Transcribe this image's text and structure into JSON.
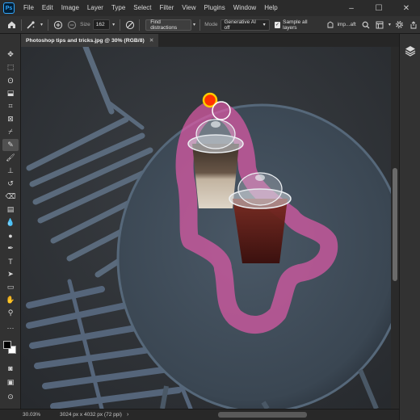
{
  "app": {
    "logo": "Ps"
  },
  "menubar": {
    "items": [
      "File",
      "Edit",
      "Image",
      "Layer",
      "Type",
      "Select",
      "Filter",
      "View",
      "Plugins",
      "Window",
      "Help"
    ]
  },
  "window_controls": {
    "minimize": "–",
    "maximize": "☐",
    "close": "✕"
  },
  "options_bar": {
    "size_label": "Size",
    "size_value": "162",
    "find_distractions": "Find distractions",
    "mode_label": "Mode",
    "mode_value": "Generative AI off",
    "sample_all_layers": "Sample all layers",
    "sample_checked": "✓",
    "truncated_label": "imp...aft"
  },
  "document": {
    "tab_title": "Photoshop tips and tricks.jpg @ 30% (RGB/8)",
    "close": "✕"
  },
  "status": {
    "zoom": "30.03%",
    "dimensions": "3024 px x 4032 px (72 ppi)"
  },
  "colors": {
    "accent": "#31a8ff",
    "mask": "#e05aa8",
    "brush_cursor": "#ff3300"
  }
}
